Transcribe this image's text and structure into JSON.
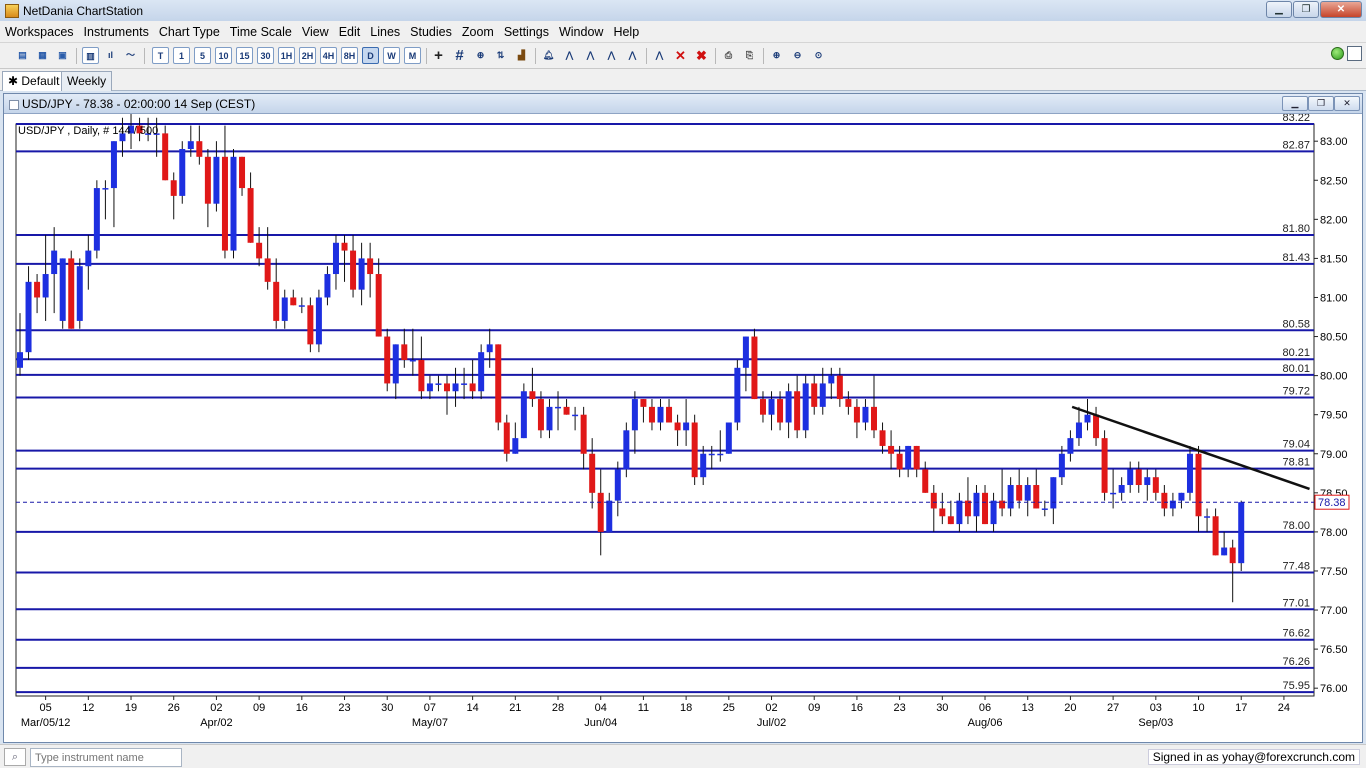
{
  "window": {
    "title": "NetDania ChartStation"
  },
  "menu": [
    "Workspaces",
    "Instruments",
    "Chart Type",
    "Time Scale",
    "View",
    "Edit",
    "Lines",
    "Studies",
    "Zoom",
    "Settings",
    "Window",
    "Help"
  ],
  "toolbar": {
    "periods": [
      "T",
      "1",
      "5",
      "10",
      "15",
      "30",
      "1H",
      "2H",
      "4H",
      "8H",
      "D",
      "W",
      "M"
    ],
    "active_period": "D"
  },
  "tabs": {
    "default": "Default",
    "weekly": "Weekly"
  },
  "chart_window": {
    "title": "USD/JPY - 78.38 - 02:00:00  14 Sep (CEST)"
  },
  "status": {
    "input_placeholder": "Type instrument name",
    "signed_in": "Signed in as yohay@forexcrunch.com"
  },
  "chart_data": {
    "type": "candlestick",
    "info_label": "USD/JPY , Daily, # 144 / 500",
    "ylim": [
      75.9,
      83.22
    ],
    "y_ticks": [
      {
        "v": 83.0,
        "t": "83.00"
      },
      {
        "v": 82.5,
        "t": "82.50"
      },
      {
        "v": 82.0,
        "t": "82.00"
      },
      {
        "v": 81.5,
        "t": "81.50"
      },
      {
        "v": 81.0,
        "t": "81.00"
      },
      {
        "v": 80.5,
        "t": "80.50"
      },
      {
        "v": 80.0,
        "t": "80.00"
      },
      {
        "v": 79.5,
        "t": "79.50"
      },
      {
        "v": 79.0,
        "t": "79.00"
      },
      {
        "v": 78.5,
        "t": "78.50"
      },
      {
        "v": 78.0,
        "t": "78.00"
      },
      {
        "v": 77.5,
        "t": "77.50"
      },
      {
        "v": 77.0,
        "t": "77.00"
      },
      {
        "v": 76.5,
        "t": "76.50"
      },
      {
        "v": 76.0,
        "t": "76.00"
      }
    ],
    "h_lines": [
      {
        "v": 83.22,
        "t": "83.22"
      },
      {
        "v": 82.87,
        "t": "82.87"
      },
      {
        "v": 81.8,
        "t": "81.80"
      },
      {
        "v": 81.43,
        "t": "81.43"
      },
      {
        "v": 80.58,
        "t": "80.58"
      },
      {
        "v": 80.21,
        "t": "80.21"
      },
      {
        "v": 80.01,
        "t": "80.01"
      },
      {
        "v": 79.72,
        "t": "79.72"
      },
      {
        "v": 79.04,
        "t": "79.04"
      },
      {
        "v": 78.81,
        "t": "78.81"
      },
      {
        "v": 78.0,
        "t": "78.00"
      },
      {
        "v": 77.48,
        "t": "77.48"
      },
      {
        "v": 77.01,
        "t": "77.01"
      },
      {
        "v": 76.62,
        "t": "76.62"
      },
      {
        "v": 76.26,
        "t": "76.26"
      },
      {
        "v": 75.95,
        "t": "75.95"
      }
    ],
    "last_price": {
      "v": 78.38,
      "t": "78.38"
    },
    "x_ticks": [
      {
        "i": 3,
        "t": "05"
      },
      {
        "i": 8,
        "t": "12"
      },
      {
        "i": 13,
        "t": "19"
      },
      {
        "i": 18,
        "t": "26"
      },
      {
        "i": 23,
        "t": "02"
      },
      {
        "i": 28,
        "t": "09"
      },
      {
        "i": 33,
        "t": "16"
      },
      {
        "i": 38,
        "t": "23"
      },
      {
        "i": 43,
        "t": "30"
      },
      {
        "i": 48,
        "t": "07"
      },
      {
        "i": 53,
        "t": "14"
      },
      {
        "i": 58,
        "t": "21"
      },
      {
        "i": 63,
        "t": "28"
      },
      {
        "i": 68,
        "t": "04"
      },
      {
        "i": 73,
        "t": "11"
      },
      {
        "i": 78,
        "t": "18"
      },
      {
        "i": 83,
        "t": "25"
      },
      {
        "i": 88,
        "t": "02"
      },
      {
        "i": 93,
        "t": "09"
      },
      {
        "i": 98,
        "t": "16"
      },
      {
        "i": 103,
        "t": "23"
      },
      {
        "i": 108,
        "t": "30"
      },
      {
        "i": 113,
        "t": "06"
      },
      {
        "i": 118,
        "t": "13"
      },
      {
        "i": 123,
        "t": "20"
      },
      {
        "i": 128,
        "t": "27"
      },
      {
        "i": 133,
        "t": "03"
      },
      {
        "i": 138,
        "t": "10"
      },
      {
        "i": 143,
        "t": "17"
      },
      {
        "i": 148,
        "t": "24"
      }
    ],
    "month_ticks": [
      {
        "i": 3,
        "t": "Mar/05/12"
      },
      {
        "i": 23,
        "t": "Apr/02"
      },
      {
        "i": 48,
        "t": "May/07"
      },
      {
        "i": 68,
        "t": "Jun/04"
      },
      {
        "i": 88,
        "t": "Jul/02"
      },
      {
        "i": 113,
        "t": "Aug/06"
      },
      {
        "i": 133,
        "t": "Sep/03"
      }
    ],
    "trendline": {
      "from": {
        "i": 123.2,
        "v": 79.6
      },
      "to": {
        "i": 151,
        "v": 78.55
      }
    },
    "ohlc": [
      [
        80.1,
        80.8,
        80.0,
        80.3
      ],
      [
        80.3,
        81.4,
        80.2,
        81.2
      ],
      [
        81.2,
        81.3,
        80.8,
        81.0
      ],
      [
        81.0,
        81.8,
        80.7,
        81.3
      ],
      [
        81.3,
        81.9,
        80.8,
        81.6
      ],
      [
        80.7,
        81.5,
        80.6,
        81.5
      ],
      [
        81.5,
        81.6,
        80.6,
        80.6
      ],
      [
        80.7,
        81.5,
        80.6,
        81.4
      ],
      [
        81.4,
        81.8,
        81.1,
        81.6
      ],
      [
        81.6,
        82.5,
        81.5,
        82.4
      ],
      [
        82.4,
        82.5,
        82.0,
        82.4
      ],
      [
        82.4,
        83.0,
        81.9,
        83.0
      ],
      [
        83.0,
        83.3,
        82.8,
        83.1
      ],
      [
        83.1,
        83.4,
        82.9,
        83.2
      ],
      [
        83.2,
        83.3,
        83.0,
        83.1
      ],
      [
        83.1,
        83.3,
        83.0,
        83.1
      ],
      [
        83.1,
        83.3,
        82.8,
        83.1
      ],
      [
        83.1,
        83.2,
        82.5,
        82.5
      ],
      [
        82.5,
        82.6,
        82.0,
        82.3
      ],
      [
        82.3,
        83.0,
        82.2,
        82.9
      ],
      [
        82.9,
        83.2,
        82.8,
        83.0
      ],
      [
        83.0,
        83.2,
        82.7,
        82.8
      ],
      [
        82.8,
        82.9,
        81.9,
        82.2
      ],
      [
        82.2,
        83.0,
        82.1,
        82.8
      ],
      [
        82.8,
        83.2,
        81.5,
        81.6
      ],
      [
        81.6,
        82.9,
        81.5,
        82.8
      ],
      [
        82.8,
        82.8,
        82.3,
        82.4
      ],
      [
        82.4,
        82.6,
        81.7,
        81.7
      ],
      [
        81.7,
        81.9,
        81.4,
        81.5
      ],
      [
        81.5,
        81.9,
        81.1,
        81.2
      ],
      [
        81.2,
        81.5,
        80.6,
        80.7
      ],
      [
        80.7,
        81.1,
        80.6,
        81.0
      ],
      [
        81.0,
        81.1,
        80.9,
        80.9
      ],
      [
        80.9,
        81.0,
        80.8,
        80.9
      ],
      [
        80.9,
        81.0,
        80.3,
        80.4
      ],
      [
        80.4,
        81.1,
        80.3,
        81.0
      ],
      [
        81.0,
        81.4,
        80.9,
        81.3
      ],
      [
        81.3,
        81.8,
        81.1,
        81.7
      ],
      [
        81.7,
        81.8,
        81.2,
        81.6
      ],
      [
        81.6,
        81.8,
        81.0,
        81.1
      ],
      [
        81.1,
        81.7,
        80.9,
        81.5
      ],
      [
        81.5,
        81.7,
        81.0,
        81.3
      ],
      [
        81.3,
        81.5,
        80.5,
        80.5
      ],
      [
        80.5,
        80.6,
        79.8,
        79.9
      ],
      [
        79.9,
        80.4,
        79.7,
        80.4
      ],
      [
        80.4,
        80.6,
        80.1,
        80.2
      ],
      [
        80.2,
        80.6,
        80.0,
        80.2
      ],
      [
        80.2,
        80.5,
        79.7,
        79.8
      ],
      [
        79.8,
        80.0,
        79.7,
        79.9
      ],
      [
        79.9,
        80.0,
        79.8,
        79.9
      ],
      [
        79.9,
        80.0,
        79.5,
        79.8
      ],
      [
        79.8,
        80.1,
        79.6,
        79.9
      ],
      [
        79.9,
        80.1,
        79.7,
        79.9
      ],
      [
        79.9,
        80.2,
        79.7,
        79.8
      ],
      [
        79.8,
        80.4,
        79.7,
        80.3
      ],
      [
        80.3,
        80.6,
        80.1,
        80.4
      ],
      [
        80.4,
        80.4,
        79.3,
        79.4
      ],
      [
        79.4,
        79.5,
        78.9,
        79.0
      ],
      [
        79.0,
        79.4,
        79.0,
        79.2
      ],
      [
        79.2,
        79.9,
        79.2,
        79.8
      ],
      [
        79.8,
        80.1,
        79.6,
        79.7
      ],
      [
        79.7,
        79.8,
        79.2,
        79.3
      ],
      [
        79.3,
        79.7,
        79.2,
        79.6
      ],
      [
        79.6,
        79.8,
        79.3,
        79.6
      ],
      [
        79.6,
        79.7,
        79.5,
        79.5
      ],
      [
        79.5,
        79.6,
        79.3,
        79.5
      ],
      [
        79.5,
        79.6,
        78.8,
        79.0
      ],
      [
        79.0,
        79.2,
        78.3,
        78.5
      ],
      [
        78.5,
        78.8,
        77.7,
        78.0
      ],
      [
        78.0,
        78.5,
        78.0,
        78.4
      ],
      [
        78.4,
        78.9,
        78.2,
        78.8
      ],
      [
        78.8,
        79.4,
        78.7,
        79.3
      ],
      [
        79.3,
        79.8,
        79.0,
        79.7
      ],
      [
        79.7,
        79.7,
        79.4,
        79.6
      ],
      [
        79.6,
        79.7,
        79.3,
        79.4
      ],
      [
        79.4,
        79.7,
        79.3,
        79.6
      ],
      [
        79.6,
        79.7,
        79.4,
        79.4
      ],
      [
        79.4,
        79.5,
        79.1,
        79.3
      ],
      [
        79.3,
        79.7,
        79.1,
        79.4
      ],
      [
        79.4,
        79.5,
        78.6,
        78.7
      ],
      [
        78.7,
        79.1,
        78.6,
        79.0
      ],
      [
        79.0,
        79.1,
        78.8,
        79.0
      ],
      [
        79.0,
        79.3,
        78.9,
        79.0
      ],
      [
        79.0,
        79.4,
        79.0,
        79.4
      ],
      [
        79.4,
        80.2,
        79.3,
        80.1
      ],
      [
        80.1,
        80.5,
        79.8,
        80.5
      ],
      [
        80.5,
        80.6,
        79.7,
        79.7
      ],
      [
        79.7,
        79.8,
        79.4,
        79.5
      ],
      [
        79.5,
        79.8,
        79.3,
        79.7
      ],
      [
        79.7,
        79.8,
        79.3,
        79.4
      ],
      [
        79.4,
        79.9,
        79.2,
        79.8
      ],
      [
        79.8,
        80.0,
        79.2,
        79.3
      ],
      [
        79.3,
        80.0,
        79.2,
        79.9
      ],
      [
        79.9,
        80.0,
        79.5,
        79.6
      ],
      [
        79.6,
        80.1,
        79.5,
        79.9
      ],
      [
        79.9,
        80.1,
        79.7,
        80.0
      ],
      [
        80.0,
        80.1,
        79.6,
        79.7
      ],
      [
        79.7,
        79.8,
        79.5,
        79.6
      ],
      [
        79.6,
        79.7,
        79.2,
        79.4
      ],
      [
        79.4,
        79.7,
        79.3,
        79.6
      ],
      [
        79.6,
        80.0,
        79.2,
        79.3
      ],
      [
        79.3,
        79.4,
        79.0,
        79.1
      ],
      [
        79.1,
        79.3,
        78.8,
        79.0
      ],
      [
        79.0,
        79.1,
        78.7,
        78.8
      ],
      [
        78.8,
        79.1,
        78.7,
        79.1
      ],
      [
        79.1,
        79.1,
        78.7,
        78.8
      ],
      [
        78.8,
        78.9,
        78.5,
        78.5
      ],
      [
        78.5,
        78.6,
        78.0,
        78.3
      ],
      [
        78.3,
        78.5,
        78.1,
        78.2
      ],
      [
        78.2,
        78.4,
        78.1,
        78.1
      ],
      [
        78.1,
        78.5,
        78.0,
        78.4
      ],
      [
        78.4,
        78.7,
        78.1,
        78.2
      ],
      [
        78.2,
        78.6,
        78.0,
        78.5
      ],
      [
        78.5,
        78.6,
        78.1,
        78.1
      ],
      [
        78.1,
        78.5,
        78.0,
        78.4
      ],
      [
        78.4,
        78.8,
        78.2,
        78.3
      ],
      [
        78.3,
        78.7,
        78.2,
        78.6
      ],
      [
        78.6,
        78.8,
        78.3,
        78.4
      ],
      [
        78.4,
        78.7,
        78.2,
        78.6
      ],
      [
        78.6,
        78.8,
        78.3,
        78.3
      ],
      [
        78.3,
        78.4,
        78.2,
        78.3
      ],
      [
        78.3,
        78.7,
        78.1,
        78.7
      ],
      [
        78.7,
        79.1,
        78.6,
        79.0
      ],
      [
        79.0,
        79.3,
        78.9,
        79.2
      ],
      [
        79.2,
        79.6,
        79.1,
        79.4
      ],
      [
        79.4,
        79.7,
        79.3,
        79.5
      ],
      [
        79.5,
        79.6,
        79.1,
        79.2
      ],
      [
        79.2,
        79.3,
        78.4,
        78.5
      ],
      [
        78.5,
        78.8,
        78.3,
        78.5
      ],
      [
        78.5,
        78.7,
        78.4,
        78.6
      ],
      [
        78.6,
        78.9,
        78.5,
        78.8
      ],
      [
        78.8,
        78.9,
        78.5,
        78.6
      ],
      [
        78.6,
        78.8,
        78.4,
        78.7
      ],
      [
        78.7,
        78.8,
        78.4,
        78.5
      ],
      [
        78.5,
        78.6,
        78.2,
        78.3
      ],
      [
        78.3,
        78.5,
        78.2,
        78.4
      ],
      [
        78.4,
        78.5,
        78.3,
        78.5
      ],
      [
        78.5,
        79.1,
        78.4,
        79.0
      ],
      [
        79.0,
        79.1,
        78.0,
        78.2
      ],
      [
        78.2,
        78.3,
        78.0,
        78.2
      ],
      [
        78.2,
        78.3,
        77.7,
        77.7
      ],
      [
        77.7,
        78.0,
        77.7,
        77.8
      ],
      [
        77.8,
        77.9,
        77.1,
        77.6
      ],
      [
        77.6,
        78.4,
        77.5,
        78.38
      ]
    ]
  }
}
